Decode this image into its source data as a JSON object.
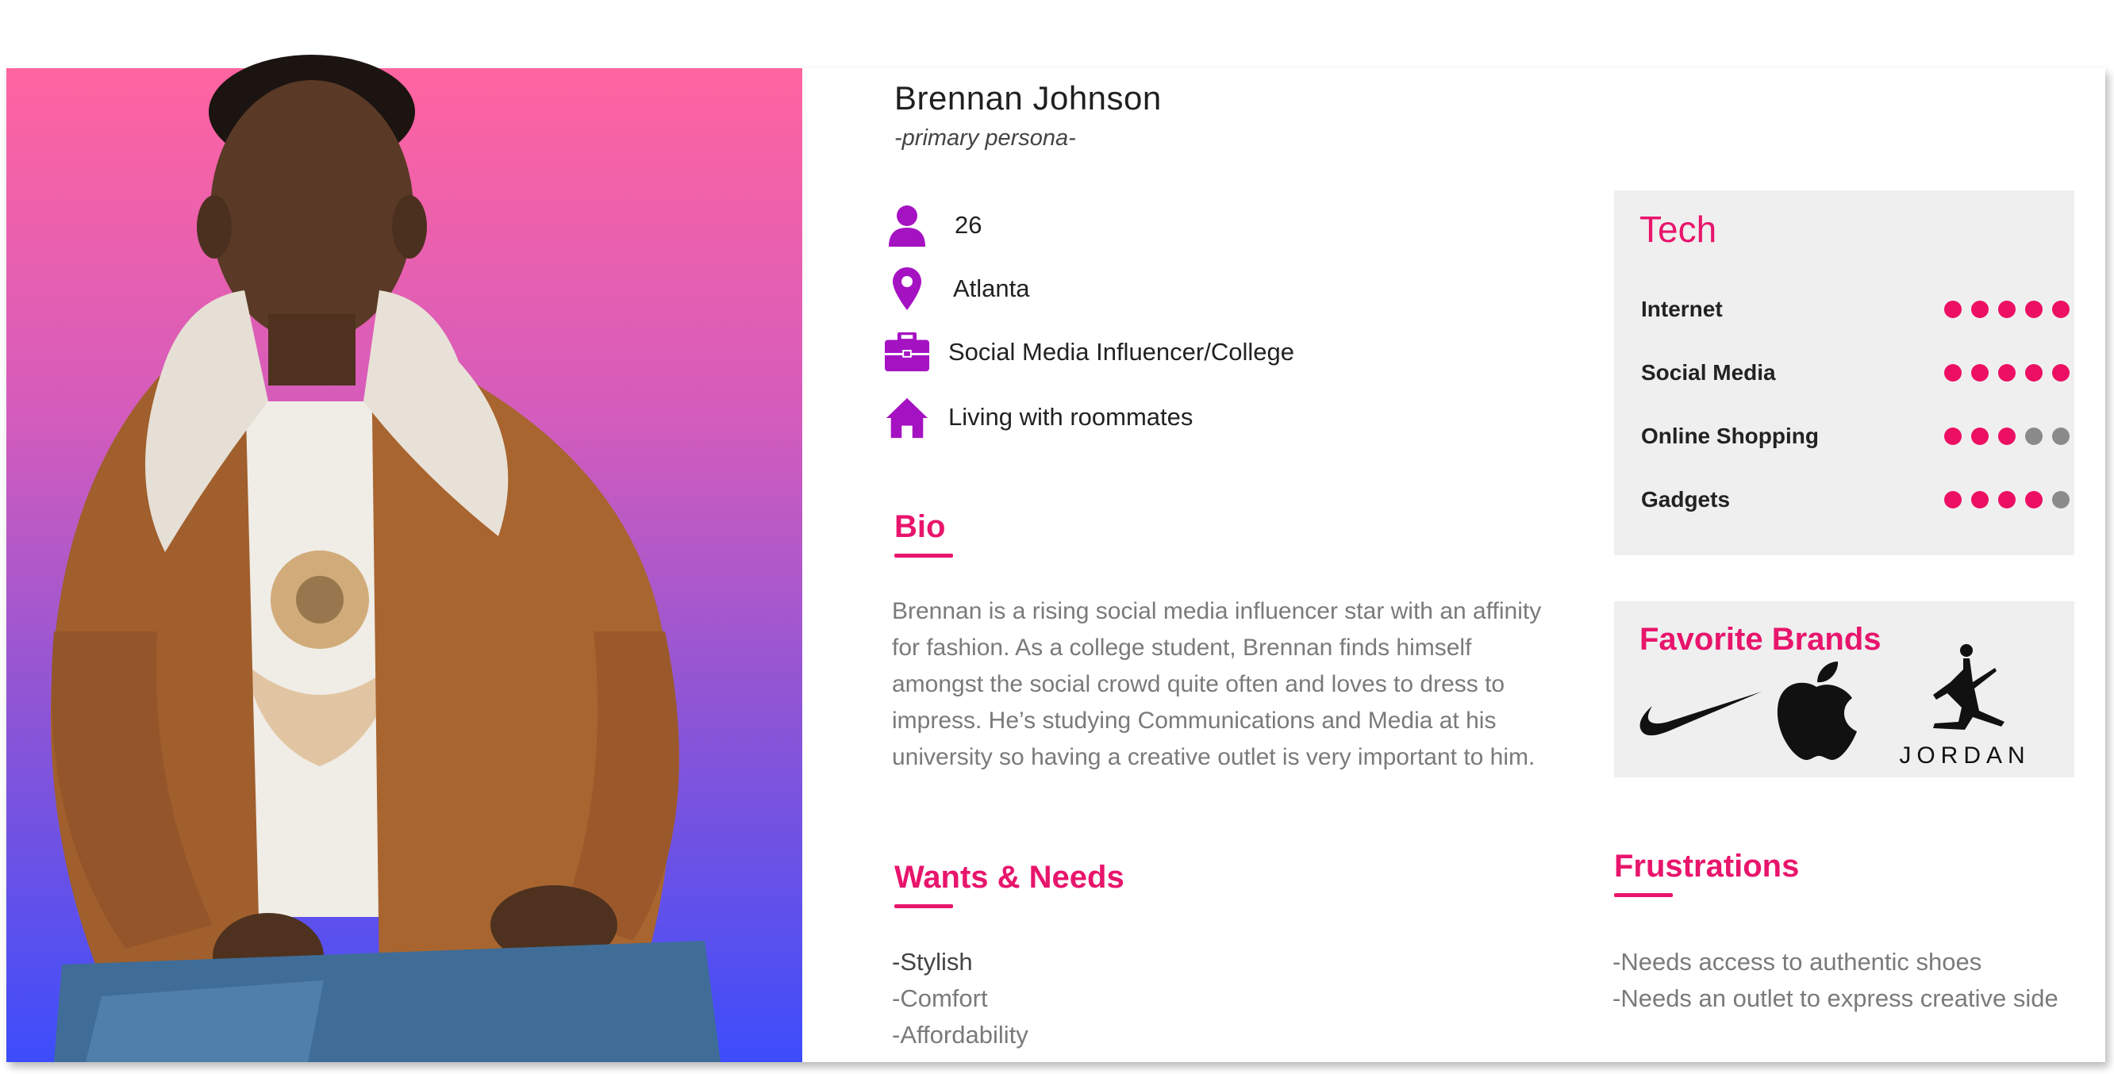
{
  "persona": {
    "name": "Brennan Johnson",
    "role": "-primary persona-"
  },
  "info": {
    "age": "26",
    "location": "Atlanta",
    "occupation": "Social Media Influencer/College",
    "living": "Living with roommates"
  },
  "icons": {
    "age": "person-icon",
    "location": "location-pin-icon",
    "occupation": "briefcase-icon",
    "living": "house-icon"
  },
  "bio": {
    "title": "Bio",
    "text": "Brennan is a rising social media influencer star with an affinity for fashion. As a college student, Brennan finds himself amongst the social crowd quite often and loves to dress to impress. He’s studying Communications and Media at his university so having a creative outlet is very important to him."
  },
  "wants": {
    "title": "Wants & Needs",
    "items": [
      "-Stylish",
      "-Comfort",
      "-Affordability"
    ]
  },
  "frustrations": {
    "title": "Frustrations",
    "items": [
      "-Needs access to authentic shoes",
      "-Needs an outlet to express creative side"
    ]
  },
  "tech": {
    "title": "Tech",
    "rating_max": 5,
    "items": [
      {
        "label": "Internet",
        "rating": 5
      },
      {
        "label": "Social Media",
        "rating": 5
      },
      {
        "label": "Online Shopping",
        "rating": 3
      },
      {
        "label": "Gadgets",
        "rating": 4
      }
    ]
  },
  "brands": {
    "title": "Favorite Brands",
    "logos": [
      "nike-logo",
      "apple-logo",
      "jordan-logo"
    ],
    "jordan_wordmark": "JORDAN"
  },
  "colors": {
    "accent": "#e8156c",
    "icon": "#a512c2",
    "dot_on": "#ec0f63",
    "dot_off": "#8a8a8a",
    "gradient_top": "#ff64a0",
    "gradient_bottom": "#3d4dfb"
  }
}
